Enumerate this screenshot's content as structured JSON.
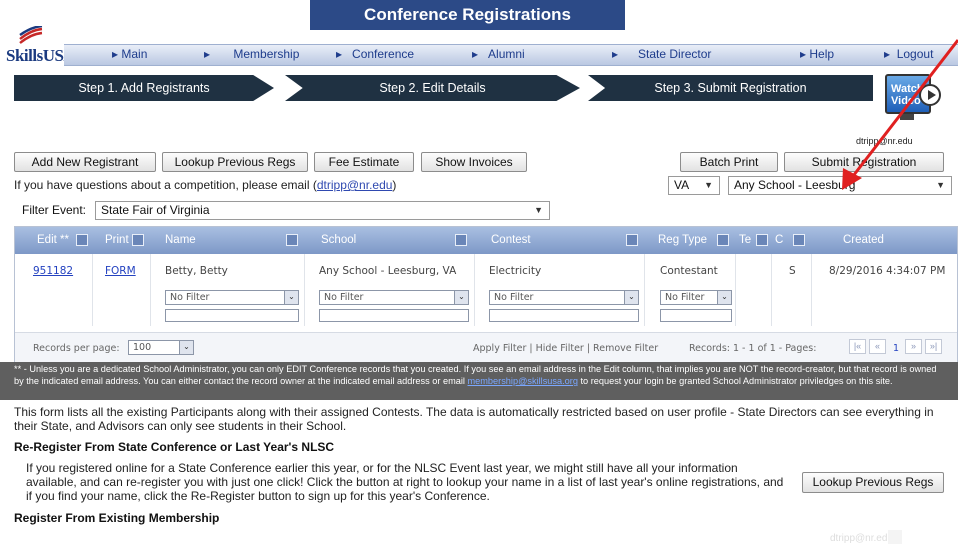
{
  "window": {
    "title": "Conference Registrations"
  },
  "logo": {
    "text": "SkillsUSA"
  },
  "nav": {
    "items": [
      "Main",
      "Membership",
      "Conference",
      "Alumni",
      "State Director",
      "Help",
      "Logout"
    ]
  },
  "steps": [
    "Step 1. Add Registrants",
    "Step 2. Edit Details",
    "Step 3. Submit Registration"
  ],
  "video": {
    "label": "Watch Video",
    "email": "dtripp@nr.edu"
  },
  "toolbar": {
    "add": "Add New Registrant",
    "lookup": "Lookup Previous Regs",
    "fee": "Fee Estimate",
    "invoices": "Show Invoices",
    "batch_print": "Batch Print",
    "submit": "Submit Registration"
  },
  "help": {
    "text": "If you have questions about a competition, please email (",
    "email": "dtripp@nr.edu",
    "close": ")"
  },
  "state_select": "VA",
  "school_select": "Any School - Leesburg",
  "filter": {
    "label": "Filter Event:",
    "value": "State Fair of Virginia"
  },
  "grid": {
    "headers": [
      "Edit **",
      "Print",
      "Name",
      "School",
      "Contest",
      "Reg Type",
      "Te",
      "C",
      "Created"
    ],
    "row": {
      "edit": "951182",
      "print": "FORM",
      "name": "Betty, Betty",
      "school": "Any School  - Leesburg, VA",
      "contest": "Electricity",
      "reg_type": "Contestant",
      "te": "",
      "c": "S",
      "created": "8/29/2016 4:34:07 PM"
    },
    "filter_placeholder": "No Filter",
    "filter_caret": "⌄",
    "footer": {
      "records_per_page_label": "Records per page:",
      "records_per_page": "100",
      "actions": "Apply Filter | Hide Filter | Remove Filter",
      "records": "Records: 1 - 1 of 1 - Pages:",
      "page": "1"
    }
  },
  "note": {
    "text": "** - Unless you are a dedicated School Administrator, you can only EDIT Conference records that you created. If you see an email address in the Edit column, that implies you are NOT the record-creator, but that record is owned by the indicated email address. You can either contact the record owner at the indicated email address or email ",
    "email": "membership@skillsusa.org",
    "text2": " to request your login be granted School Administrator priviledges on this site."
  },
  "description": "This form lists all the existing Participants along with their assigned Contests. The data is automatically restricted based on user profile - State Directors can see everything in their State, and Advisors can only see students in their School.",
  "reregister": {
    "title": "Re-Register From State Conference or Last Year's NLSC",
    "text": "If you registered online for a State Conference earlier this year, or for the NLSC Event last year, we might still have all your information available, and can re-register you with just one click! Click the button at right to lookup your name in a list of last year's online registrations, and if you find your name, click the Re-Register button to sign up for this year's Conference.",
    "button": "Lookup Previous Regs"
  },
  "existing": {
    "title": "Register From Existing Membership"
  },
  "footer": {
    "email": "dtripp@nr.edu"
  },
  "colors": {
    "title_bar": "#2c4a87",
    "step_bg": "#1f3142",
    "grid_header": "#7d98c7",
    "note_bg": "#5f5f5f",
    "arrow": "#e02020"
  }
}
